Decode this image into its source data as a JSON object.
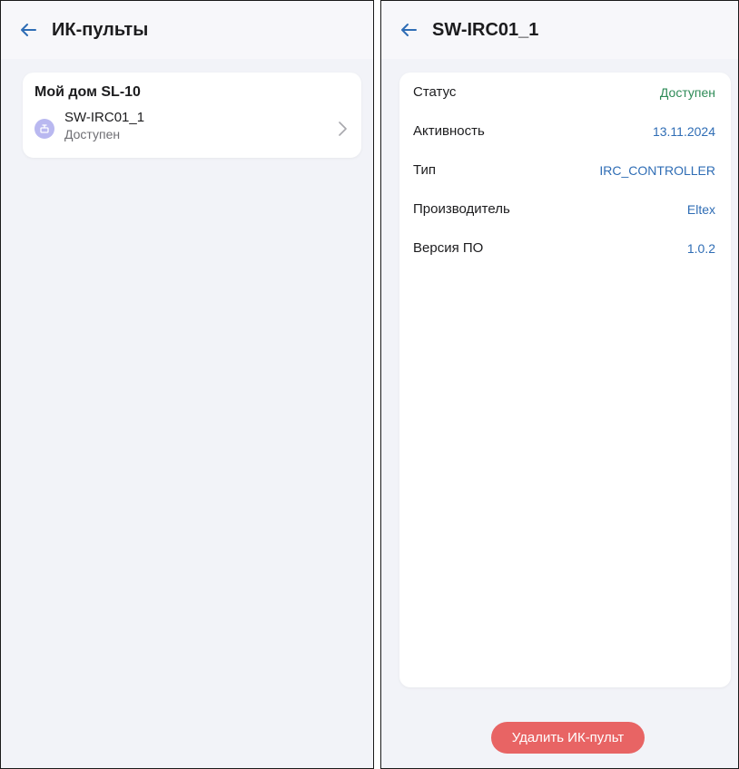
{
  "left_screen": {
    "title": "ИК-пульты",
    "group": {
      "title": "Мой дом SL-10",
      "devices": [
        {
          "name": "SW-IRC01_1",
          "status": "Доступен"
        }
      ]
    }
  },
  "right_screen": {
    "title": "SW-IRC01_1",
    "rows": [
      {
        "label": "Статус",
        "value": "Доступен"
      },
      {
        "label": "Активность",
        "value": "13.11.2024"
      },
      {
        "label": "Тип",
        "value": "IRC_CONTROLLER"
      },
      {
        "label": "Производитель",
        "value": "Eltex"
      },
      {
        "label": "Версия ПО",
        "value": "1.0.2"
      }
    ],
    "delete_label": "Удалить ИК-пульт"
  },
  "colors": {
    "accent": "#2f6db5",
    "status_ok": "#2e8b57",
    "danger": "#e86464",
    "avatar": "#b9b8f0",
    "background": "#f2f3f8"
  },
  "icons": [
    "arrow-left-icon",
    "remote-icon",
    "chevron-right-icon"
  ]
}
